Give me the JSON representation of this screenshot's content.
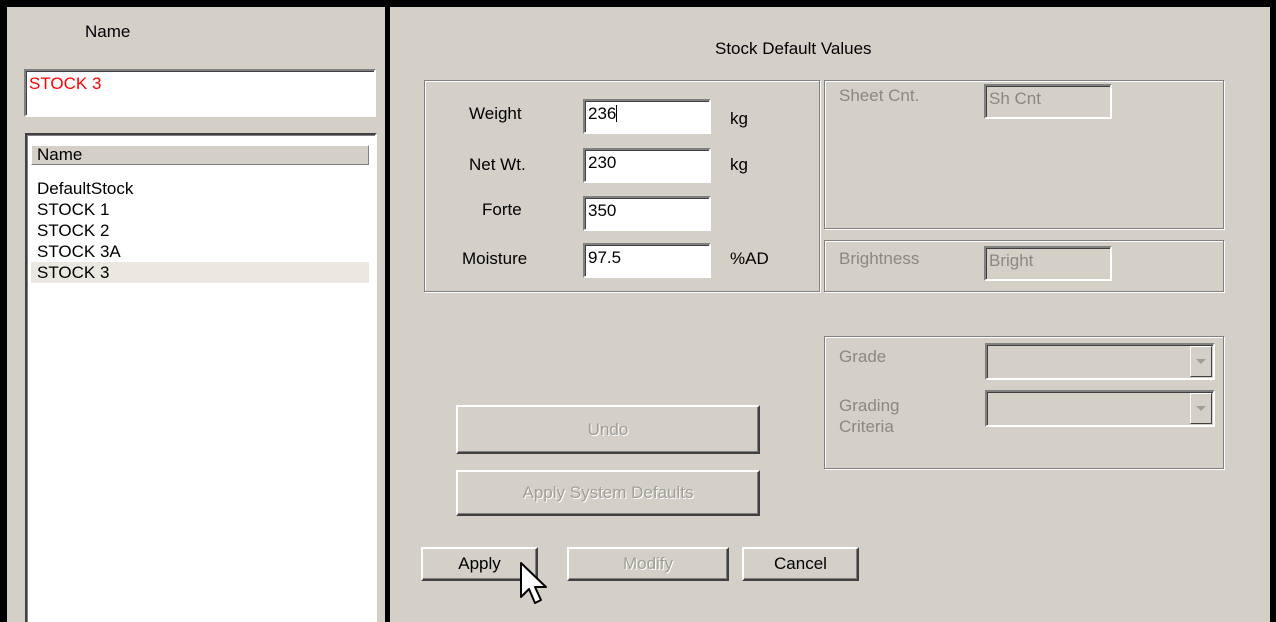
{
  "left_panel": {
    "name_label": "Name",
    "name_value": "STOCK 3",
    "list_header": "Name",
    "items": [
      "DefaultStock",
      "STOCK 1",
      "STOCK 2",
      "STOCK 3A",
      "STOCK 3"
    ],
    "selected_item": "STOCK 3"
  },
  "right_panel": {
    "title": "Stock Default Values",
    "fields": [
      {
        "label": "Weight",
        "value": "236",
        "unit": "kg"
      },
      {
        "label": "Net Wt.",
        "value": "230",
        "unit": "kg"
      },
      {
        "label": "Forte",
        "value": "350",
        "unit": ""
      },
      {
        "label": "Moisture",
        "value": "97.5",
        "unit": "%AD"
      }
    ],
    "sheet_count": {
      "label": "Sheet Cnt.",
      "value": "Sh Cnt"
    },
    "brightness": {
      "label": "Brightness",
      "value": "Bright"
    },
    "grade": {
      "label": "Grade",
      "value": ""
    },
    "grading_criteria": {
      "label_line1": "Grading",
      "label_line2": "Criteria",
      "value": ""
    },
    "buttons": {
      "undo": "Undo",
      "apply_system_defaults": "Apply System Defaults",
      "apply": "Apply",
      "modify": "Modify",
      "cancel": "Cancel"
    }
  },
  "colors": {
    "name_value_text": "#ff0000",
    "dialog_background": "#d4d0c8",
    "disabled_text": "#8a8880",
    "selected_row": "#ebe8e1"
  }
}
